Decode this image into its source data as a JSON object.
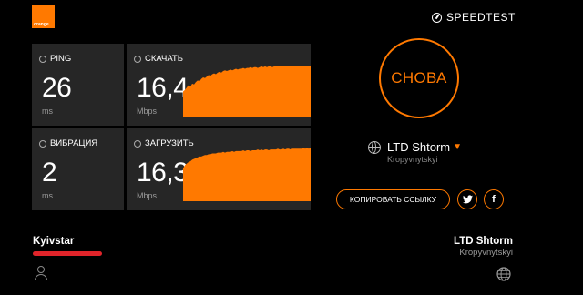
{
  "brand": {
    "logo_text": "orange",
    "accent": "#ff7900"
  },
  "header": {
    "speedtest_label": "SPEEDTEST"
  },
  "tiles": {
    "ping": {
      "label": "PING",
      "value": "26",
      "unit": "ms"
    },
    "download": {
      "label": "СКАЧАТЬ",
      "value": "16,4",
      "unit": "Mbps"
    },
    "jitter": {
      "label": "ВИБРАЦИЯ",
      "value": "2",
      "unit": "ms"
    },
    "upload": {
      "label": "ЗАГРУЗИТЬ",
      "value": "16,3",
      "unit": "Mbps"
    }
  },
  "again_button": "СНОВА",
  "server": {
    "name": "LTD Shtorm",
    "city": "Kropyvnytskyi"
  },
  "share": {
    "copy_link": "КОПИРОВАТЬ ССЫЛКУ",
    "twitter_icon": "twitter-icon",
    "facebook_icon": "facebook-icon"
  },
  "footer": {
    "isp": "Kyivstar",
    "host_name": "LTD Shtorm",
    "host_city": "Kropyvnytskyi"
  }
}
